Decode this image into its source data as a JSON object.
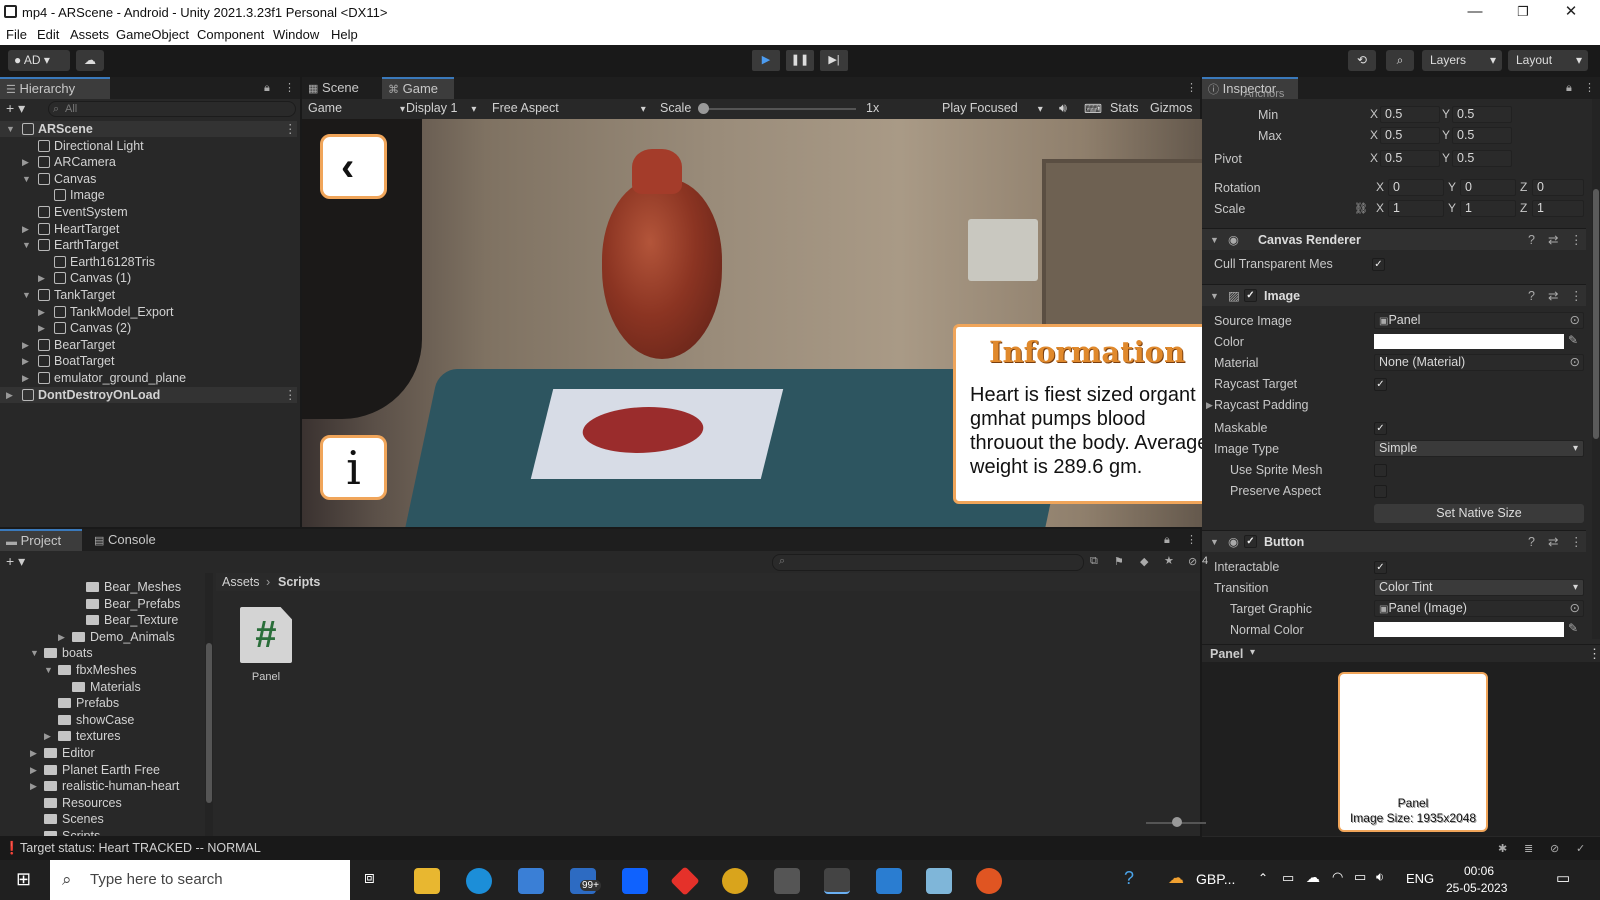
{
  "window": {
    "title": "mp4 - ARScene - Android - Unity 2021.3.23f1 Personal <DX11>",
    "controls": [
      "—",
      "❐",
      "✕"
    ]
  },
  "menu": [
    "File",
    "Edit",
    "Assets",
    "GameObject",
    "Component",
    "Window",
    "Help"
  ],
  "toolbar": {
    "account": "AD",
    "layers": "Layers",
    "layout": "Layout"
  },
  "hierarchy": {
    "tab": "Hierarchy",
    "search_placeholder": "All",
    "items": [
      {
        "label": "ARScene",
        "depth": 0,
        "expanded": true,
        "scene": true
      },
      {
        "label": "Directional Light",
        "depth": 1
      },
      {
        "label": "ARCamera",
        "depth": 1,
        "collapsed": true
      },
      {
        "label": "Canvas",
        "depth": 1,
        "expanded": true
      },
      {
        "label": "Image",
        "depth": 2
      },
      {
        "label": "EventSystem",
        "depth": 1
      },
      {
        "label": "HeartTarget",
        "depth": 1,
        "collapsed": true
      },
      {
        "label": "EarthTarget",
        "depth": 1,
        "expanded": true
      },
      {
        "label": "Earth16128Tris",
        "depth": 2
      },
      {
        "label": "Canvas (1)",
        "depth": 2,
        "collapsed": true
      },
      {
        "label": "TankTarget",
        "depth": 1,
        "expanded": true
      },
      {
        "label": "TankModel_Export",
        "depth": 2,
        "collapsed": true
      },
      {
        "label": "Canvas (2)",
        "depth": 2,
        "collapsed": true
      },
      {
        "label": "BearTarget",
        "depth": 1,
        "collapsed": true
      },
      {
        "label": "BoatTarget",
        "depth": 1,
        "collapsed": true
      },
      {
        "label": "emulator_ground_plane",
        "depth": 1,
        "collapsed": true
      },
      {
        "label": "DontDestroyOnLoad",
        "depth": 0,
        "collapsed": true,
        "scene": true
      }
    ]
  },
  "game": {
    "tabs": [
      "Scene",
      "Game"
    ],
    "view_mode": "Game",
    "display": "Display 1",
    "aspect": "Free Aspect",
    "scale_label": "Scale",
    "scale_value": "1x",
    "play_mode": "Play Focused",
    "stats": "Stats",
    "gizmos": "Gizmos",
    "info_button": "i",
    "info_panel": {
      "title": "Information",
      "body": "Heart is fiest sized organt gmhat pumps blood throuout the body. Average weight is 289.6 gm."
    }
  },
  "inspector": {
    "tab": "Inspector",
    "cut_label": "Anchors",
    "anchors_min": {
      "label": "Min",
      "x": "0.5",
      "y": "0.5"
    },
    "anchors_max": {
      "label": "Max",
      "x": "0.5",
      "y": "0.5"
    },
    "pivot": {
      "label": "Pivot",
      "x": "0.5",
      "y": "0.5"
    },
    "rotation": {
      "label": "Rotation",
      "x": "0",
      "y": "0",
      "z": "0"
    },
    "scale": {
      "label": "Scale",
      "x": "1",
      "y": "1",
      "z": "1"
    },
    "canvas_renderer": {
      "title": "Canvas Renderer",
      "cull_label": "Cull Transparent Mes",
      "cull": "✓"
    },
    "image": {
      "title": "Image",
      "source_label": "Source Image",
      "source": "Panel",
      "color_label": "Color",
      "material_label": "Material",
      "material": "None (Material)",
      "raycast_label": "Raycast Target",
      "raycast": "✓",
      "padding_label": "Raycast Padding",
      "maskable_label": "Maskable",
      "maskable": "✓",
      "type_label": "Image Type",
      "type": "Simple",
      "sprite_mesh_label": "Use Sprite Mesh",
      "preserve_label": "Preserve Aspect",
      "native_button": "Set Native Size"
    },
    "button": {
      "title": "Button",
      "interactable_label": "Interactable",
      "interactable": "✓",
      "transition_label": "Transition",
      "transition": "Color Tint",
      "target_label": "Target Graphic",
      "target": "Panel (Image)",
      "normal_label": "Normal Color"
    },
    "preview": {
      "header": "Panel",
      "caption1": "Panel",
      "caption2": "Image Size: 1935x2048"
    }
  },
  "project": {
    "tabs": [
      "Project",
      "Console"
    ],
    "breadcrumb": [
      "Assets",
      "Scripts"
    ],
    "badge": "4",
    "tree": [
      {
        "label": "Bear_Meshes",
        "depth": 4
      },
      {
        "label": "Bear_Prefabs",
        "depth": 4
      },
      {
        "label": "Bear_Texture",
        "depth": 4
      },
      {
        "label": "Demo_Animals",
        "depth": 3,
        "arrow": "▶"
      },
      {
        "label": "boats",
        "depth": 1,
        "arrow": "▼"
      },
      {
        "label": "fbxMeshes",
        "depth": 2,
        "arrow": "▼"
      },
      {
        "label": "Materials",
        "depth": 3
      },
      {
        "label": "Prefabs",
        "depth": 2
      },
      {
        "label": "showCase",
        "depth": 2
      },
      {
        "label": "textures",
        "depth": 2,
        "arrow": "▶"
      },
      {
        "label": "Editor",
        "depth": 1,
        "arrow": "▶"
      },
      {
        "label": "Planet Earth Free",
        "depth": 1,
        "arrow": "▶"
      },
      {
        "label": "realistic-human-heart",
        "depth": 1,
        "arrow": "▶"
      },
      {
        "label": "Resources",
        "depth": 1
      },
      {
        "label": "Scenes",
        "depth": 1
      },
      {
        "label": "Scripts",
        "depth": 1
      }
    ],
    "asset": {
      "name": "Panel",
      "glyph": "#"
    }
  },
  "status": "Target status: Heart TRACKED -- NORMAL",
  "taskbar": {
    "search_placeholder": "Type here to search",
    "mail_badge": "99+",
    "weather": "GBP...",
    "lang": "ENG",
    "time": "00:06",
    "date": "25-05-2023"
  }
}
